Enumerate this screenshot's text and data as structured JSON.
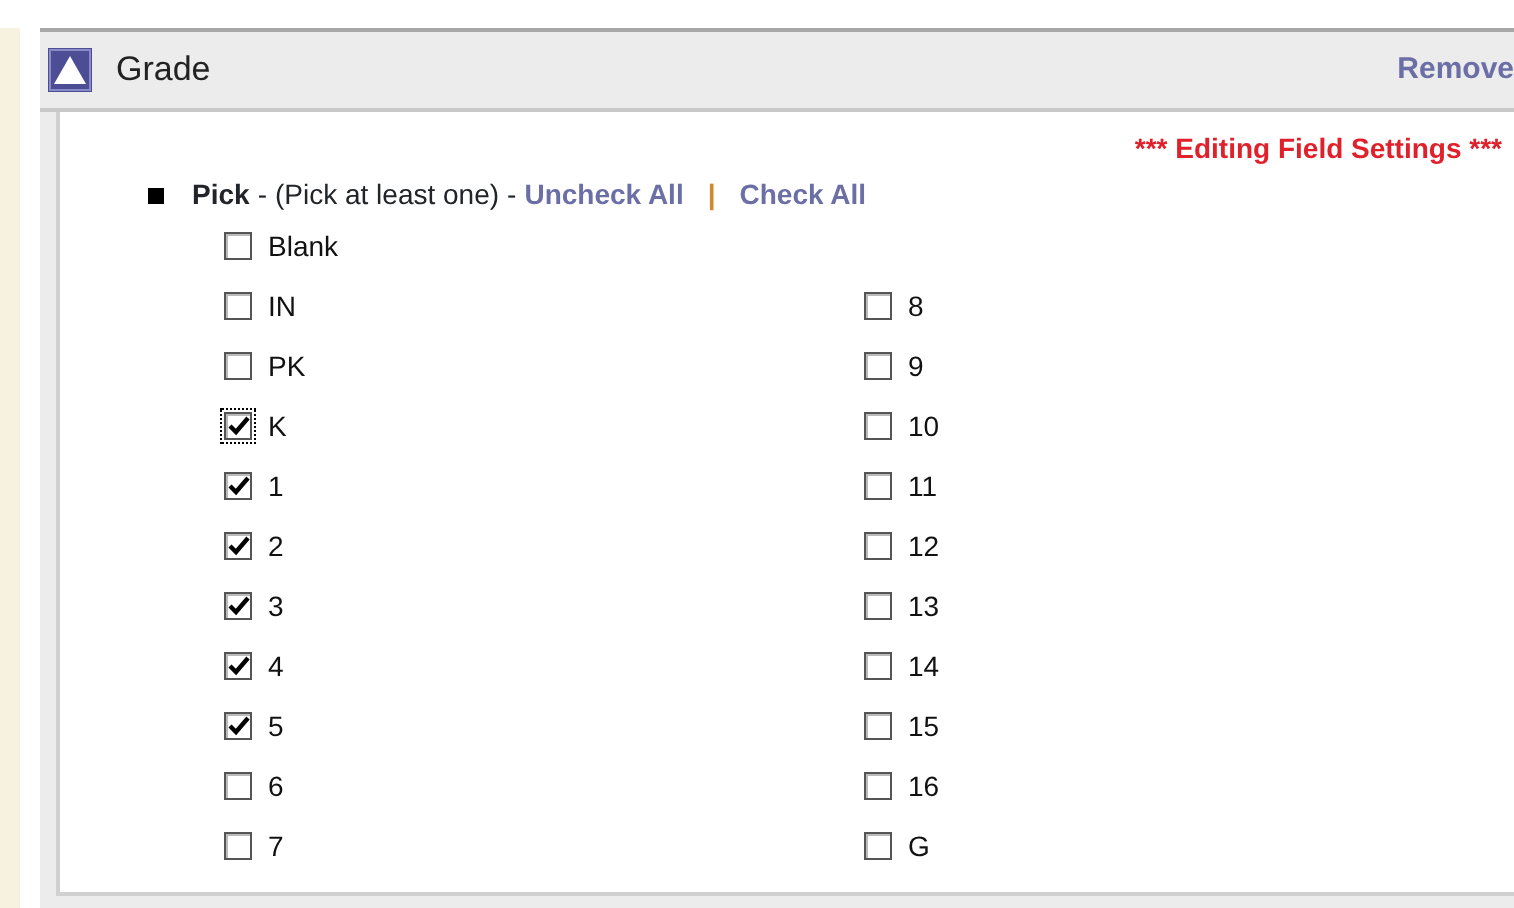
{
  "panel": {
    "title": "Grade",
    "remove_link": "Remove"
  },
  "notice": "*** Editing Field Settings ***",
  "pick": {
    "label": "Pick",
    "separator_1": "-",
    "hint": "(Pick at least one)",
    "separator_2": "-",
    "uncheck_all": "Uncheck All",
    "divider": "|",
    "check_all": "Check All"
  },
  "blank_option": {
    "label": "Blank",
    "checked": false,
    "focused": false
  },
  "left_column": [
    {
      "label": "IN",
      "checked": false,
      "focused": false
    },
    {
      "label": "PK",
      "checked": false,
      "focused": false
    },
    {
      "label": "K",
      "checked": true,
      "focused": true
    },
    {
      "label": "1",
      "checked": true,
      "focused": false
    },
    {
      "label": "2",
      "checked": true,
      "focused": false
    },
    {
      "label": "3",
      "checked": true,
      "focused": false
    },
    {
      "label": "4",
      "checked": true,
      "focused": false
    },
    {
      "label": "5",
      "checked": true,
      "focused": false
    },
    {
      "label": "6",
      "checked": false,
      "focused": false
    },
    {
      "label": "7",
      "checked": false,
      "focused": false
    }
  ],
  "right_column": [
    {
      "label": "8",
      "checked": false,
      "focused": false
    },
    {
      "label": "9",
      "checked": false,
      "focused": false
    },
    {
      "label": "10",
      "checked": false,
      "focused": false
    },
    {
      "label": "11",
      "checked": false,
      "focused": false
    },
    {
      "label": "12",
      "checked": false,
      "focused": false
    },
    {
      "label": "13",
      "checked": false,
      "focused": false
    },
    {
      "label": "14",
      "checked": false,
      "focused": false
    },
    {
      "label": "15",
      "checked": false,
      "focused": false
    },
    {
      "label": "16",
      "checked": false,
      "focused": false
    },
    {
      "label": "G",
      "checked": false,
      "focused": false
    }
  ]
}
